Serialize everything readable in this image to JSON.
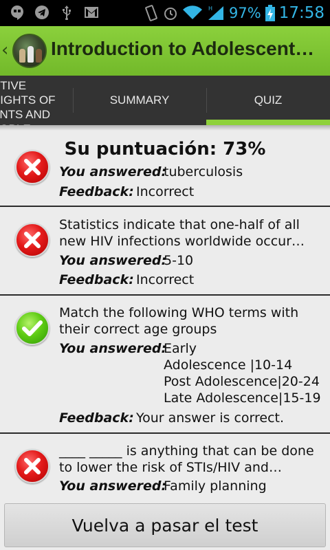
{
  "status_bar": {
    "icons": [
      "hangouts-icon",
      "telegram-icon",
      "usb-icon",
      "gmail-icon",
      "vibrate-icon",
      "alarm-icon",
      "wifi-icon",
      "signal-icon",
      "battery-charging-icon"
    ],
    "battery_percent": "97%",
    "time": "17:58"
  },
  "action_bar": {
    "title": "Introduction to Adolescent…"
  },
  "tabs": [
    {
      "label": "CTIVE\nRIGHTS OF\nENTS AND\nEOPLE"
    },
    {
      "label": "SUMMARY"
    },
    {
      "label": "QUIZ"
    }
  ],
  "score": {
    "label": "Su puntuación: 73%"
  },
  "labels": {
    "you_answered": "You answered:",
    "feedback": "Feedback:"
  },
  "results": [
    {
      "question": "",
      "answer": "tuberculosis",
      "feedback": "Incorrect",
      "correct": false
    },
    {
      "question": "Statistics indicate that one-half of all new HIV infections worldwide occur…",
      "answer": "5-10",
      "feedback": "Incorrect",
      "correct": false
    },
    {
      "question": "Match the following WHO terms with their correct age groups",
      "answer": "Early\nAdolescence |10-14\nPost Adolescence|20-24\nLate Adolescence|15-19",
      "feedback": "Your answer is correct.",
      "correct": true
    },
    {
      "question": "____ _____ is anything that can be done to lower the risk of STIs/HIV and…",
      "answer": "Family planning",
      "feedback": "",
      "correct": false
    }
  ],
  "retake_button": {
    "label": "Vuelva a pasar el test"
  },
  "colors": {
    "action_bar": "#7cc230",
    "tab_indicator": "#8ed13b",
    "status_text": "#33b5e5"
  }
}
